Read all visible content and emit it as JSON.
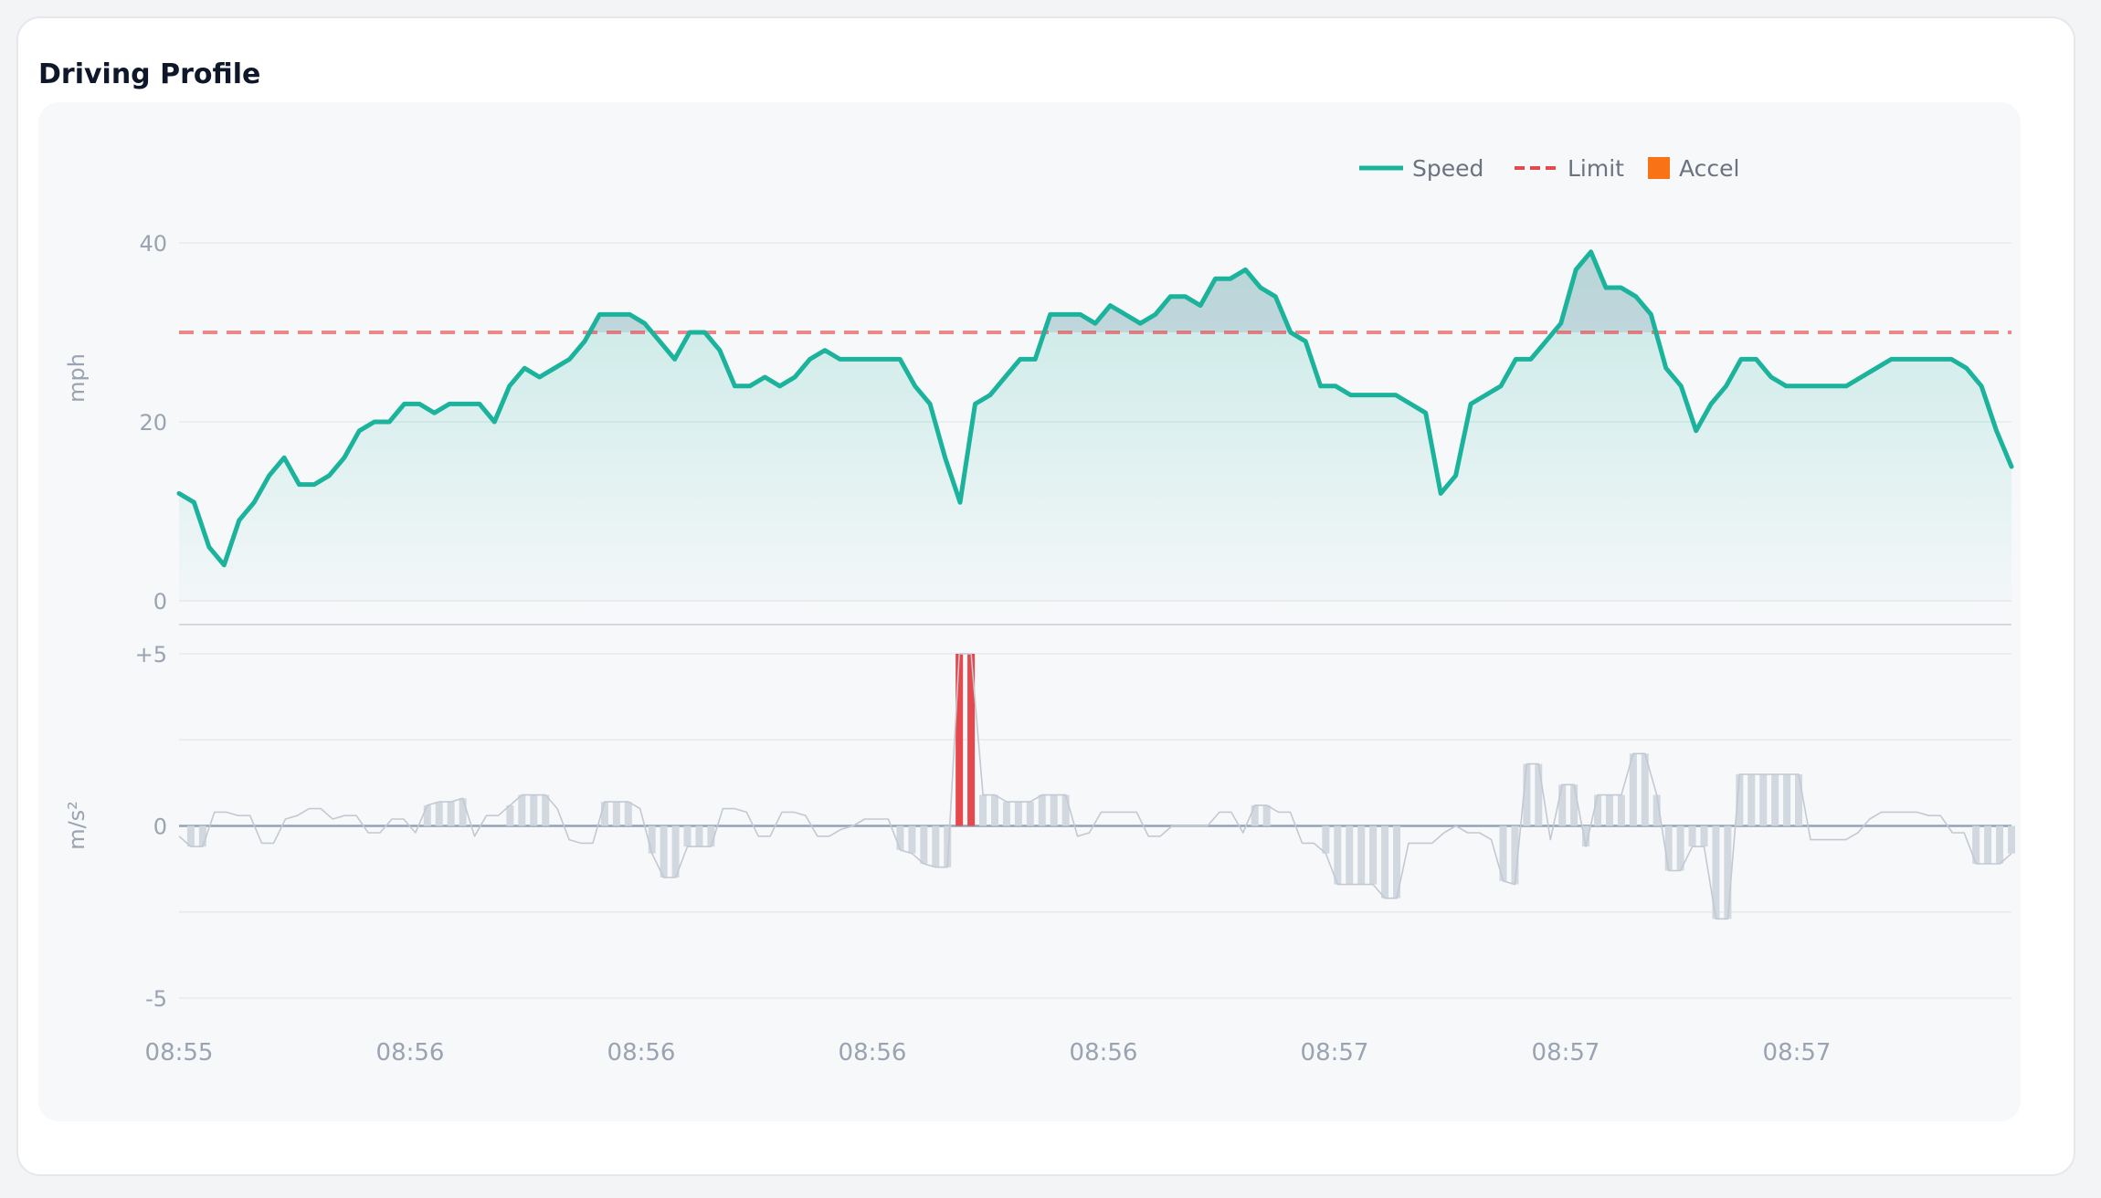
{
  "card": {
    "title": "Driving Profile"
  },
  "legend": [
    {
      "label": "Speed",
      "color": "#1bb39c",
      "kind": "line"
    },
    {
      "label": "Limit",
      "color": "#e5484d",
      "kind": "dash"
    },
    {
      "label": "Accel",
      "color": "#f97316",
      "kind": "box"
    }
  ],
  "chart_data": [
    {
      "type": "area",
      "ylabel": "mph",
      "ylim": [
        0,
        40
      ],
      "yticks": [
        "40",
        "20",
        "0"
      ],
      "limit": 30,
      "series": [
        {
          "name": "Speed",
          "color": "#1bb39c",
          "values": [
            12,
            11,
            6,
            4,
            9,
            11,
            14,
            16,
            13,
            13,
            14,
            16,
            19,
            20,
            20,
            22,
            22,
            21,
            22,
            22,
            22,
            20,
            24,
            26,
            25,
            26,
            27,
            29,
            32,
            32,
            32,
            31,
            29,
            27,
            30,
            30,
            28,
            24,
            24,
            25,
            24,
            25,
            27,
            28,
            27,
            27,
            27,
            27,
            27,
            24,
            22,
            16,
            11,
            22,
            23,
            25,
            27,
            27,
            32,
            32,
            32,
            31,
            33,
            32,
            31,
            32,
            34,
            34,
            33,
            36,
            36,
            37,
            35,
            34,
            30,
            29,
            24,
            24,
            23,
            23,
            23,
            23,
            22,
            21,
            12,
            14,
            22,
            23,
            24,
            27,
            27,
            29,
            31,
            37,
            39,
            35,
            35,
            34,
            32,
            26,
            24,
            19,
            22,
            24,
            27,
            27,
            25,
            24,
            24,
            24,
            24,
            24,
            25,
            26,
            27,
            27,
            27,
            27,
            27,
            26,
            24,
            19,
            15
          ]
        },
        {
          "name": "Limit",
          "color": "#e5484d",
          "values": [
            30
          ]
        }
      ]
    },
    {
      "type": "bar",
      "ylabel": "m/s²",
      "ylim": [
        -5,
        5
      ],
      "yticks": [
        "+5",
        "0",
        "-5"
      ],
      "series": [
        {
          "name": "Accel",
          "color": "#f97316",
          "values": [
            -0.3,
            -0.6,
            -0.6,
            0.4,
            0.4,
            0.3,
            0.3,
            -0.5,
            -0.5,
            0.2,
            0.3,
            0.5,
            0.5,
            0.2,
            0.3,
            0.3,
            -0.2,
            -0.2,
            0.2,
            0.2,
            -0.2,
            0.6,
            0.7,
            0.7,
            0.8,
            -0.3,
            0.3,
            0.3,
            0.6,
            0.9,
            0.9,
            0.9,
            0.5,
            -0.4,
            -0.5,
            -0.5,
            0.7,
            0.7,
            0.7,
            0.5,
            -0.8,
            -1.5,
            -1.5,
            -0.6,
            -0.6,
            -0.6,
            0.5,
            0.5,
            0.4,
            -0.3,
            -0.3,
            0.4,
            0.4,
            0.3,
            -0.3,
            -0.3,
            -0.1,
            0.0,
            0.2,
            0.2,
            0.2,
            -0.7,
            -0.8,
            -1.1,
            -1.2,
            -1.2,
            5.0,
            5.0,
            0.9,
            0.9,
            0.7,
            0.7,
            0.7,
            0.9,
            0.9,
            0.9,
            -0.3,
            -0.2,
            0.4,
            0.4,
            0.4,
            0.4,
            -0.3,
            -0.3,
            0.0,
            0.0,
            0.0,
            0.0,
            0.4,
            0.4,
            -0.2,
            0.6,
            0.6,
            0.4,
            0.4,
            -0.5,
            -0.5,
            -0.8,
            -1.7,
            -1.7,
            -1.7,
            -1.7,
            -2.1,
            -2.1,
            -0.5,
            -0.5,
            -0.5,
            -0.2,
            0.0,
            -0.2,
            -0.2,
            -0.4,
            -1.6,
            -1.7,
            1.8,
            1.8,
            -0.4,
            1.2,
            1.2,
            -0.6,
            0.9,
            0.9,
            0.9,
            2.1,
            2.1,
            0.9,
            -1.3,
            -1.3,
            -0.6,
            -0.6,
            -2.7,
            -2.7,
            1.5,
            1.5,
            1.5,
            1.5,
            1.5,
            1.5,
            -0.4,
            -0.4,
            -0.4,
            -0.4,
            -0.2,
            0.2,
            0.4,
            0.4,
            0.4,
            0.4,
            0.3,
            0.3,
            -0.2,
            -0.2,
            -1.1,
            -1.1,
            -1.1,
            -0.8
          ]
        }
      ]
    }
  ],
  "xticks": [
    "08:55",
    "08:56",
    "08:56",
    "08:56",
    "08:56",
    "08:57",
    "08:57",
    "08:57"
  ]
}
